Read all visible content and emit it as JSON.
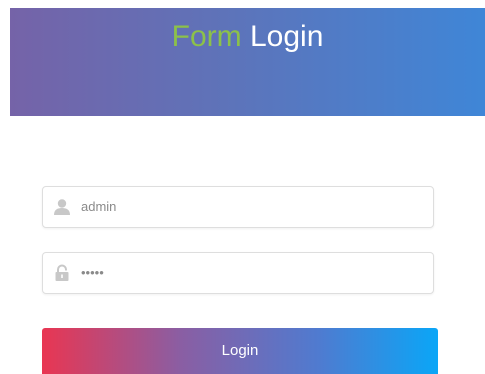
{
  "header": {
    "title_accent": "Form",
    "title_main": "Login",
    "accent_color": "#8cc14a",
    "gradient_start": "#7563a8",
    "gradient_end": "#3f86d7"
  },
  "form": {
    "username": {
      "value": "admin",
      "icon": "user-icon"
    },
    "password": {
      "value": "•••••",
      "icon": "lock-icon"
    },
    "submit_label": "Login",
    "button_gradient": [
      "#e93652",
      "#8a5ea3",
      "#4f7bd0",
      "#0aa6f7"
    ]
  }
}
